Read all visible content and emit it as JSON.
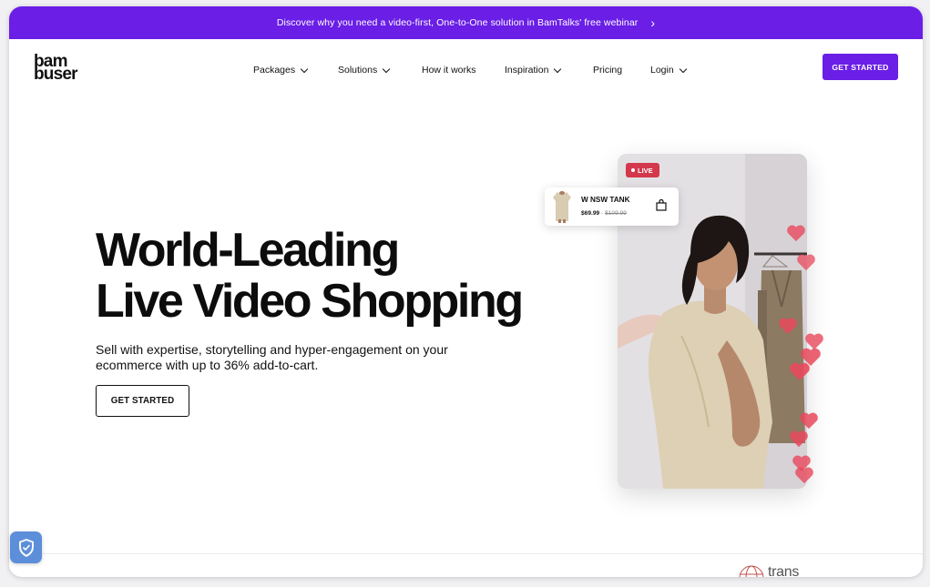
{
  "banner": {
    "text": "Discover why you need a video-first, One-to-One solution in BamTalks' free webinar",
    "arrow_icon": "chevron-right-icon"
  },
  "header": {
    "logo_line1": "bam",
    "logo_line2": "buser",
    "nav": [
      {
        "label": "Packages",
        "has_dropdown": true
      },
      {
        "label": "Solutions",
        "has_dropdown": true
      },
      {
        "label": "How it works",
        "has_dropdown": false
      },
      {
        "label": "Inspiration",
        "has_dropdown": true
      },
      {
        "label": "Pricing",
        "has_dropdown": false
      },
      {
        "label": "Login",
        "has_dropdown": true
      }
    ],
    "cta_label": "GET STARTED"
  },
  "hero": {
    "headline_line1": "World-Leading",
    "headline_line2": "Live Video Shopping",
    "subtext": "Sell with expertise, storytelling and hyper-engagement on your ecommerce with up to 36% add-to-cart.",
    "cta_label": "GET STARTED"
  },
  "video": {
    "live_label": "LIVE",
    "product_name": "W NSW TANK",
    "price_now": "$69.99",
    "price_separator": "·",
    "price_was": "$109.99"
  },
  "footer_strip": {
    "partner_logo_text": "trans"
  },
  "colors": {
    "brand": "#6a1ee6",
    "live": "#d4384c",
    "heart": "#e8495c",
    "shield": "#5d8ed9"
  }
}
